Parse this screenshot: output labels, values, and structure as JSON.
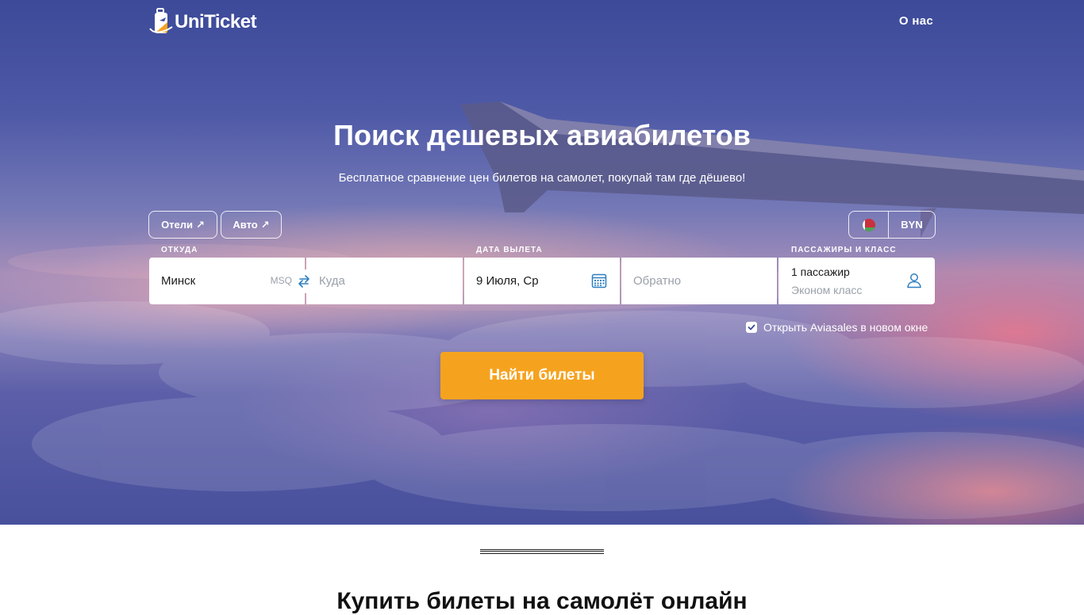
{
  "brand": {
    "name": "UniTicket"
  },
  "nav": {
    "about": "О нас"
  },
  "hero": {
    "title": "Поиск дешевых авиабилетов",
    "subtitle": "Бесплатное сравнение цен билетов на самолет, покупай там где дёшево!"
  },
  "links": {
    "hotels": "Отели",
    "auto": "Авто",
    "external_icon": "↗"
  },
  "currency": {
    "code": "BYN",
    "flag_icon": "belarus-flag-icon"
  },
  "search": {
    "labels": {
      "from": "ОТКУДА",
      "date": "ДАТА ВЫЛЕТА",
      "passengers": "ПАССАЖИРЫ И КЛАСС"
    },
    "from_value": "Минск",
    "from_code": "MSQ",
    "to_placeholder": "Куда",
    "date_value": "9 Июля, Ср",
    "return_placeholder": "Обратно",
    "passengers": "1 пассажир",
    "class": "Эконом класс",
    "new_window_label": "Открыть Aviasales в новом окне",
    "new_window_checked": true,
    "submit": "Найти билеты"
  },
  "section": {
    "title": "Купить билеты на самолёт онлайн"
  },
  "colors": {
    "accent": "#f5a31f",
    "icon_blue": "#2e7fc1",
    "sky_top": "#3c4a99"
  }
}
